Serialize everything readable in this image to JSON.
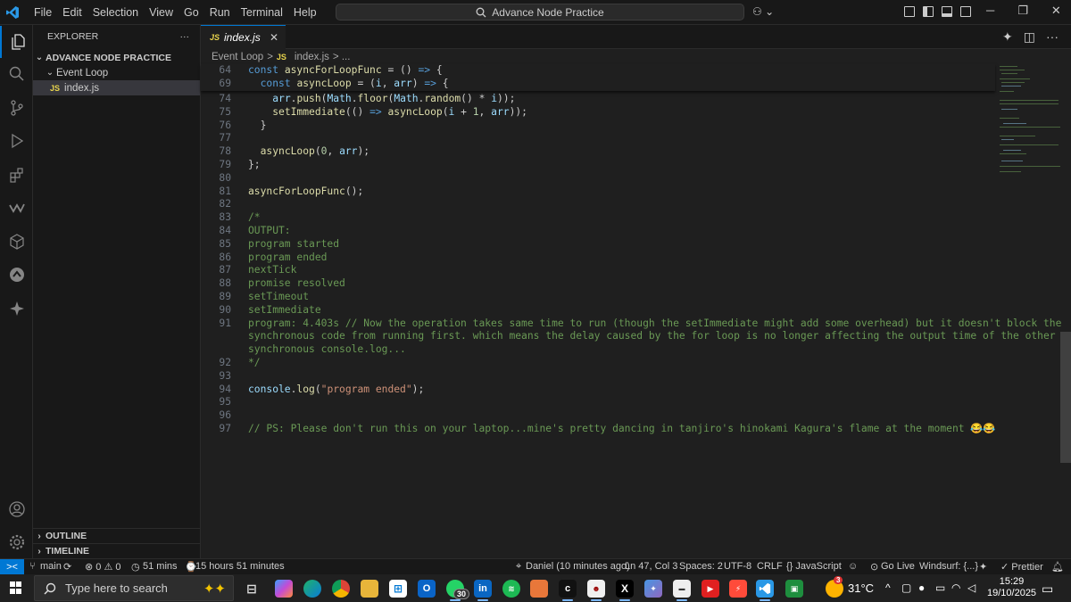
{
  "titlebar": {
    "menu": [
      "File",
      "Edit",
      "Selection",
      "View",
      "Go",
      "Run",
      "Terminal",
      "Help"
    ],
    "search_text": "Advance Node Practice"
  },
  "explorer": {
    "title": "EXPLORER",
    "more": "···",
    "project": "ADVANCE NODE PRACTICE",
    "folder": "Event Loop",
    "file_badge": "JS",
    "file": "index.js",
    "outline": "OUTLINE",
    "timeline": "TIMELINE"
  },
  "tab": {
    "badge": "JS",
    "label": "index.js",
    "close": "✕"
  },
  "breadcrumb": {
    "folder": "Event Loop",
    "sep": ">",
    "badge": "JS",
    "file": "index.js",
    "tail": "> ..."
  },
  "line_numbers": [
    "64",
    "69",
    "74",
    "75",
    "76",
    "77",
    "78",
    "79",
    "80",
    "81",
    "82",
    "83",
    "84",
    "85",
    "86",
    "87",
    "88",
    "89",
    "90",
    "91",
    "",
    "",
    "92",
    "93",
    "94",
    "95",
    "96",
    "97"
  ],
  "code_lines": [
    "const asyncForLoopFunc = () => {",
    "  const asyncLoop = (i, arr) => {",
    "    arr.push(Math.floor(Math.random() * i));",
    "    setImmediate(() => asyncLoop(i + 1, arr));",
    "  }",
    "",
    "  asyncLoop(0, arr);",
    "};",
    "",
    "asyncForLoopFunc();",
    "",
    "/*",
    "OUTPUT:",
    "program started",
    "program ended",
    "nextTick",
    "promise resolved",
    "setTimeout",
    "setImmediate",
    "program: 4.403s // Now the operation takes same time to run (though the setImmediate might add some overhead) but it doesn't block the",
    "synchronous code from running first. which means the delay caused by the for loop is no longer affecting the output time of the other",
    "synchronous console.log...",
    "*/",
    "",
    "console.log(\"program ended\");",
    "",
    "",
    "// PS: Please don't run this on your laptop...mine's pretty dancing in tanjiro's hinokami Kagura's flame at the moment 😂😂"
  ],
  "status": {
    "remote": "><",
    "branch": "main",
    "problems": "⊗ 0 ⚠ 0",
    "timer": "51 mins",
    "session": "15 hours 51 minutes",
    "blame": "Daniel (10 minutes ago)",
    "cursor": "Ln 47, Col 3",
    "spaces": "Spaces: 2",
    "encoding": "UTF-8",
    "eol": "CRLF",
    "language": "{} JavaScript",
    "golive": "Go Live",
    "windsurf": "Windsurf: {...}",
    "prettier": "✓ Prettier"
  },
  "taskbar": {
    "search_placeholder": "Type here to search",
    "whatsapp_badge": "30",
    "weather_badge": "3",
    "temperature": "31°C",
    "time": "15:29",
    "date": "19/10/2025"
  },
  "colors": {
    "accent": "#0078d4",
    "editor_bg": "#1f1f1f",
    "chrome_bg": "#181818"
  }
}
